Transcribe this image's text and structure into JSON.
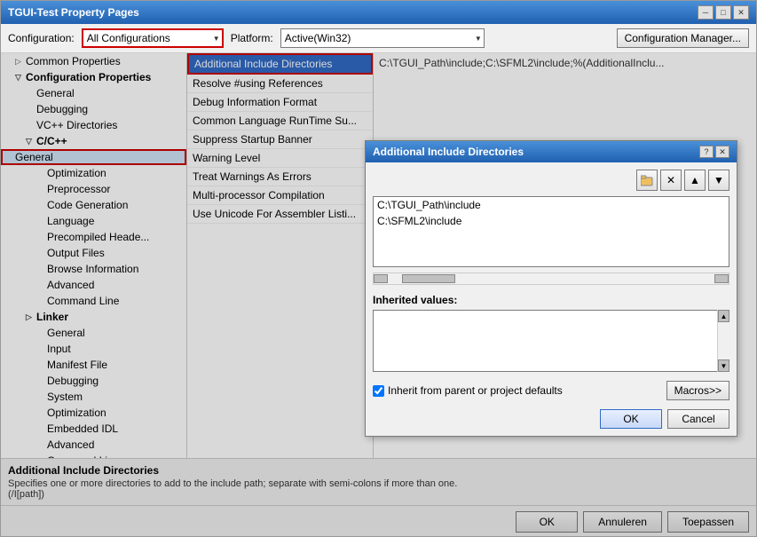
{
  "window": {
    "title": "TGUI-Test Property Pages",
    "title_btn_minimize": "─",
    "title_btn_maximize": "□",
    "title_btn_close": "✕"
  },
  "config_row": {
    "config_label": "Configuration:",
    "config_value": "All Configurations",
    "platform_label": "Platform:",
    "platform_value": "Active(Win32)",
    "manager_btn": "Configuration Manager..."
  },
  "tree": {
    "items": [
      {
        "indent": 1,
        "arrow": "▷",
        "label": "Common Properties",
        "selected": false,
        "bold": false
      },
      {
        "indent": 1,
        "arrow": "▽",
        "label": "Configuration Properties",
        "selected": false,
        "bold": true
      },
      {
        "indent": 2,
        "arrow": "",
        "label": "General",
        "selected": false,
        "bold": false
      },
      {
        "indent": 2,
        "arrow": "",
        "label": "Debugging",
        "selected": false,
        "bold": false
      },
      {
        "indent": 2,
        "arrow": "",
        "label": "VC++ Directories",
        "selected": false,
        "bold": false
      },
      {
        "indent": 2,
        "arrow": "▽",
        "label": "C/C++",
        "selected": false,
        "bold": true
      },
      {
        "indent": 3,
        "arrow": "",
        "label": "General",
        "selected": true,
        "bold": false,
        "boxed": true
      },
      {
        "indent": 3,
        "arrow": "",
        "label": "Optimization",
        "selected": false,
        "bold": false
      },
      {
        "indent": 3,
        "arrow": "",
        "label": "Preprocessor",
        "selected": false,
        "bold": false
      },
      {
        "indent": 3,
        "arrow": "",
        "label": "Code Generation",
        "selected": false,
        "bold": false
      },
      {
        "indent": 3,
        "arrow": "",
        "label": "Language",
        "selected": false,
        "bold": false
      },
      {
        "indent": 3,
        "arrow": "",
        "label": "Precompiled Heade...",
        "selected": false,
        "bold": false
      },
      {
        "indent": 3,
        "arrow": "",
        "label": "Output Files",
        "selected": false,
        "bold": false
      },
      {
        "indent": 3,
        "arrow": "",
        "label": "Browse Information",
        "selected": false,
        "bold": false
      },
      {
        "indent": 3,
        "arrow": "",
        "label": "Advanced",
        "selected": false,
        "bold": false
      },
      {
        "indent": 3,
        "arrow": "",
        "label": "Command Line",
        "selected": false,
        "bold": false
      },
      {
        "indent": 2,
        "arrow": "▷",
        "label": "Linker",
        "selected": false,
        "bold": true
      },
      {
        "indent": 3,
        "arrow": "",
        "label": "General",
        "selected": false,
        "bold": false
      },
      {
        "indent": 3,
        "arrow": "",
        "label": "Input",
        "selected": false,
        "bold": false
      },
      {
        "indent": 3,
        "arrow": "",
        "label": "Manifest File",
        "selected": false,
        "bold": false
      },
      {
        "indent": 3,
        "arrow": "",
        "label": "Debugging",
        "selected": false,
        "bold": false
      },
      {
        "indent": 3,
        "arrow": "",
        "label": "System",
        "selected": false,
        "bold": false
      },
      {
        "indent": 3,
        "arrow": "",
        "label": "Optimization",
        "selected": false,
        "bold": false
      },
      {
        "indent": 3,
        "arrow": "",
        "label": "Embedded IDL",
        "selected": false,
        "bold": false
      },
      {
        "indent": 3,
        "arrow": "",
        "label": "Advanced",
        "selected": false,
        "bold": false
      },
      {
        "indent": 3,
        "arrow": "",
        "label": "Command Line...",
        "selected": false,
        "bold": false
      }
    ]
  },
  "props": {
    "items": [
      {
        "label": "Additional Include Directories",
        "selected": true
      },
      {
        "label": "Resolve #using References",
        "selected": false
      },
      {
        "label": "Debug Information Format",
        "selected": false
      },
      {
        "label": "Common Language RunTime Su...",
        "selected": false
      },
      {
        "label": "Suppress Startup Banner",
        "selected": false
      },
      {
        "label": "Warning Level",
        "selected": false
      },
      {
        "label": "Treat Warnings As Errors",
        "selected": false
      },
      {
        "label": "Multi-processor Compilation",
        "selected": false
      },
      {
        "label": "Use Unicode For Assembler Listi...",
        "selected": false
      }
    ]
  },
  "value_display": "C:\\TGUI_Path\\include;C:\\SFML2\\include;%(AdditionalInclu...",
  "bottom": {
    "title": "Additional Include Directories",
    "desc1": "Specifies one or more directories to add to the include path; separate with semi-colons if more than one.",
    "desc2": "(/I[path])",
    "btn_ok": "OK",
    "btn_cancel": "Annuleren",
    "btn_apply": "Toepassen"
  },
  "dialog": {
    "title": "Additional Include Directories",
    "btn_help": "?",
    "btn_close": "✕",
    "toolbar": {
      "btn_folder": "📁",
      "btn_delete": "✕",
      "btn_up": "▲",
      "btn_down": "▼"
    },
    "list_items": [
      "C:\\TGUI_Path\\include",
      "C:\\SFML2\\include"
    ],
    "inherited_label": "Inherited values:",
    "checkbox_label": "Inherit from parent or project defaults",
    "macros_btn": "Macros>>",
    "ok_btn": "OK",
    "cancel_btn": "Cancel"
  }
}
